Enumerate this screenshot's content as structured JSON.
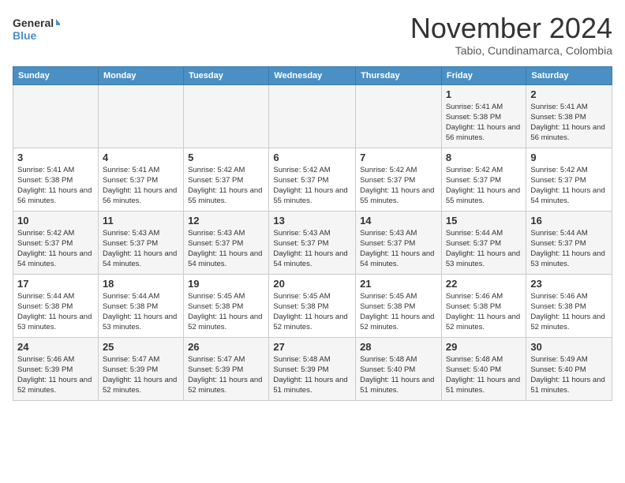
{
  "header": {
    "logo_line1": "General",
    "logo_line2": "Blue",
    "month": "November 2024",
    "location": "Tabio, Cundinamarca, Colombia"
  },
  "days_of_week": [
    "Sunday",
    "Monday",
    "Tuesday",
    "Wednesday",
    "Thursday",
    "Friday",
    "Saturday"
  ],
  "weeks": [
    [
      {
        "day": "",
        "info": ""
      },
      {
        "day": "",
        "info": ""
      },
      {
        "day": "",
        "info": ""
      },
      {
        "day": "",
        "info": ""
      },
      {
        "day": "",
        "info": ""
      },
      {
        "day": "1",
        "info": "Sunrise: 5:41 AM\nSunset: 5:38 PM\nDaylight: 11 hours and 56 minutes."
      },
      {
        "day": "2",
        "info": "Sunrise: 5:41 AM\nSunset: 5:38 PM\nDaylight: 11 hours and 56 minutes."
      }
    ],
    [
      {
        "day": "3",
        "info": "Sunrise: 5:41 AM\nSunset: 5:38 PM\nDaylight: 11 hours and 56 minutes."
      },
      {
        "day": "4",
        "info": "Sunrise: 5:41 AM\nSunset: 5:37 PM\nDaylight: 11 hours and 56 minutes."
      },
      {
        "day": "5",
        "info": "Sunrise: 5:42 AM\nSunset: 5:37 PM\nDaylight: 11 hours and 55 minutes."
      },
      {
        "day": "6",
        "info": "Sunrise: 5:42 AM\nSunset: 5:37 PM\nDaylight: 11 hours and 55 minutes."
      },
      {
        "day": "7",
        "info": "Sunrise: 5:42 AM\nSunset: 5:37 PM\nDaylight: 11 hours and 55 minutes."
      },
      {
        "day": "8",
        "info": "Sunrise: 5:42 AM\nSunset: 5:37 PM\nDaylight: 11 hours and 55 minutes."
      },
      {
        "day": "9",
        "info": "Sunrise: 5:42 AM\nSunset: 5:37 PM\nDaylight: 11 hours and 54 minutes."
      }
    ],
    [
      {
        "day": "10",
        "info": "Sunrise: 5:42 AM\nSunset: 5:37 PM\nDaylight: 11 hours and 54 minutes."
      },
      {
        "day": "11",
        "info": "Sunrise: 5:43 AM\nSunset: 5:37 PM\nDaylight: 11 hours and 54 minutes."
      },
      {
        "day": "12",
        "info": "Sunrise: 5:43 AM\nSunset: 5:37 PM\nDaylight: 11 hours and 54 minutes."
      },
      {
        "day": "13",
        "info": "Sunrise: 5:43 AM\nSunset: 5:37 PM\nDaylight: 11 hours and 54 minutes."
      },
      {
        "day": "14",
        "info": "Sunrise: 5:43 AM\nSunset: 5:37 PM\nDaylight: 11 hours and 54 minutes."
      },
      {
        "day": "15",
        "info": "Sunrise: 5:44 AM\nSunset: 5:37 PM\nDaylight: 11 hours and 53 minutes."
      },
      {
        "day": "16",
        "info": "Sunrise: 5:44 AM\nSunset: 5:37 PM\nDaylight: 11 hours and 53 minutes."
      }
    ],
    [
      {
        "day": "17",
        "info": "Sunrise: 5:44 AM\nSunset: 5:38 PM\nDaylight: 11 hours and 53 minutes."
      },
      {
        "day": "18",
        "info": "Sunrise: 5:44 AM\nSunset: 5:38 PM\nDaylight: 11 hours and 53 minutes."
      },
      {
        "day": "19",
        "info": "Sunrise: 5:45 AM\nSunset: 5:38 PM\nDaylight: 11 hours and 52 minutes."
      },
      {
        "day": "20",
        "info": "Sunrise: 5:45 AM\nSunset: 5:38 PM\nDaylight: 11 hours and 52 minutes."
      },
      {
        "day": "21",
        "info": "Sunrise: 5:45 AM\nSunset: 5:38 PM\nDaylight: 11 hours and 52 minutes."
      },
      {
        "day": "22",
        "info": "Sunrise: 5:46 AM\nSunset: 5:38 PM\nDaylight: 11 hours and 52 minutes."
      },
      {
        "day": "23",
        "info": "Sunrise: 5:46 AM\nSunset: 5:38 PM\nDaylight: 11 hours and 52 minutes."
      }
    ],
    [
      {
        "day": "24",
        "info": "Sunrise: 5:46 AM\nSunset: 5:39 PM\nDaylight: 11 hours and 52 minutes."
      },
      {
        "day": "25",
        "info": "Sunrise: 5:47 AM\nSunset: 5:39 PM\nDaylight: 11 hours and 52 minutes."
      },
      {
        "day": "26",
        "info": "Sunrise: 5:47 AM\nSunset: 5:39 PM\nDaylight: 11 hours and 52 minutes."
      },
      {
        "day": "27",
        "info": "Sunrise: 5:48 AM\nSunset: 5:39 PM\nDaylight: 11 hours and 51 minutes."
      },
      {
        "day": "28",
        "info": "Sunrise: 5:48 AM\nSunset: 5:40 PM\nDaylight: 11 hours and 51 minutes."
      },
      {
        "day": "29",
        "info": "Sunrise: 5:48 AM\nSunset: 5:40 PM\nDaylight: 11 hours and 51 minutes."
      },
      {
        "day": "30",
        "info": "Sunrise: 5:49 AM\nSunset: 5:40 PM\nDaylight: 11 hours and 51 minutes."
      }
    ]
  ]
}
